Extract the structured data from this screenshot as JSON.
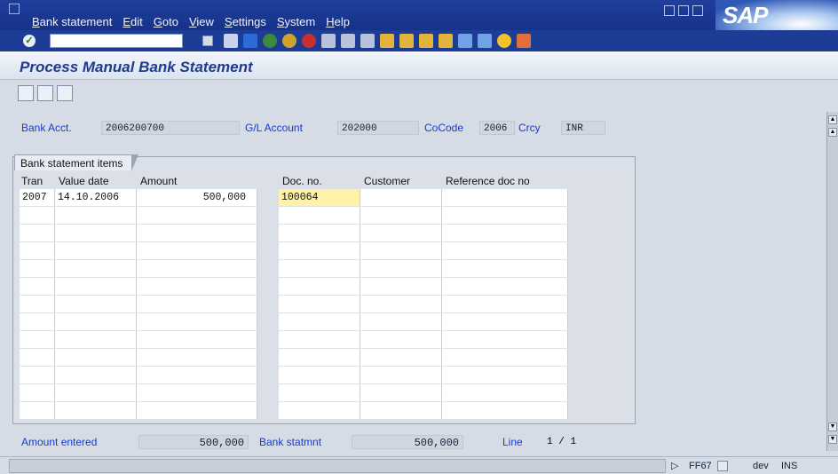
{
  "menubar": {
    "items": [
      "Bank statement",
      "Edit",
      "Goto",
      "View",
      "Settings",
      "System",
      "Help"
    ],
    "logo": "SAP"
  },
  "title": "Process Manual Bank Statement",
  "header": {
    "bank_acct_label": "Bank Acct.",
    "bank_acct_value": "2006200700",
    "gl_account_label": "G/L Account",
    "gl_account_value": "202000",
    "cocode_label": "CoCode",
    "cocode_value": "2006",
    "crcy_label": "Crcy",
    "crcy_value": "INR"
  },
  "items": {
    "tab_label": "Bank statement items",
    "columns": {
      "tran": "Tran",
      "value_date": "Value date",
      "amount": "Amount",
      "doc_no": "Doc. no.",
      "customer": "Customer",
      "reference": "Reference doc no"
    },
    "rows": [
      {
        "tran": "2007",
        "value_date": "14.10.2006",
        "amount": "500,000",
        "doc_no": "100064",
        "customer": "",
        "reference": ""
      }
    ]
  },
  "footer": {
    "amount_entered_label": "Amount entered",
    "amount_entered_value": "500,000",
    "bank_statmnt_label": "Bank statmnt",
    "bank_statmnt_value": "500,000",
    "line_label": "Line",
    "line_current": "1",
    "line_sep": "/",
    "line_total": "1"
  },
  "status": {
    "transaction": "FF67",
    "system": "dev",
    "mode": "INS"
  },
  "colors": {
    "menubar": "#1f3f9c",
    "label_blue": "#1a3ac8",
    "title_blue": "#1f3b8c",
    "focus_yellow": "#fff2a8"
  }
}
